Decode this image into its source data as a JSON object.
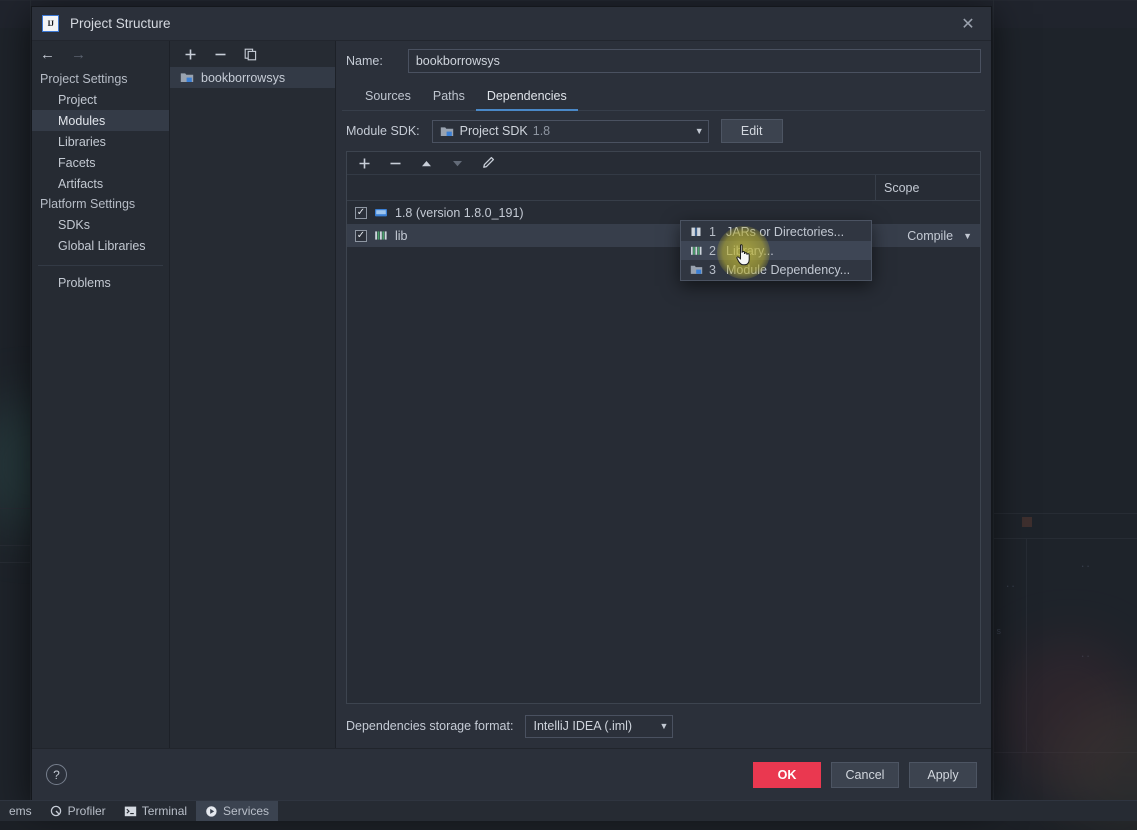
{
  "window": {
    "title": "Project Structure",
    "logo_text": "IJ",
    "close_icon": "close-icon"
  },
  "nav": {
    "back_icon": "arrow-left-icon",
    "forward_icon": "arrow-right-icon",
    "groups": [
      {
        "label": "Project Settings",
        "items": [
          {
            "label": "Project",
            "selected": false
          },
          {
            "label": "Modules",
            "selected": true
          },
          {
            "label": "Libraries",
            "selected": false
          },
          {
            "label": "Facets",
            "selected": false
          },
          {
            "label": "Artifacts",
            "selected": false
          }
        ]
      },
      {
        "label": "Platform Settings",
        "items": [
          {
            "label": "SDKs",
            "selected": false
          },
          {
            "label": "Global Libraries",
            "selected": false
          }
        ]
      }
    ],
    "problems_label": "Problems"
  },
  "modules_panel": {
    "toolbar": {
      "add_icon": "plus-icon",
      "remove_icon": "minus-icon",
      "copy_icon": "copy-icon"
    },
    "items": [
      {
        "label": "bookborrowsys",
        "icon": "module-icon",
        "selected": true
      }
    ]
  },
  "detail": {
    "name_label": "Name:",
    "name_value": "bookborrowsys",
    "name_placeholder": "",
    "tabs": [
      {
        "label": "Sources",
        "active": false
      },
      {
        "label": "Paths",
        "active": false
      },
      {
        "label": "Dependencies",
        "active": true
      }
    ],
    "sdk": {
      "label": "Module SDK:",
      "value": "Project SDK",
      "value_suffix": "1.8",
      "icon": "sdk-folder-icon",
      "edit_label": "Edit"
    },
    "dep_toolbar": {
      "add_icon": "plus-icon",
      "remove_icon": "minus-icon",
      "move_up_icon": "arrow-up-icon",
      "move_down_icon": "arrow-down-icon",
      "edit_icon": "pencil-icon"
    },
    "table": {
      "headers": {
        "export": "",
        "main": "",
        "scope": "Scope"
      },
      "rows": [
        {
          "checked": true,
          "icon": "sdk-icon",
          "label": "1.8 (version 1.8.0_191)",
          "scope": "",
          "selected": false,
          "occluded": true
        },
        {
          "checked": true,
          "icon": "library-icon",
          "label": "lib",
          "scope": "Compile",
          "selected": true,
          "occluded": false
        }
      ]
    },
    "storage": {
      "label": "Dependencies storage format:",
      "value": "IntelliJ IDEA (.iml)"
    }
  },
  "popup_menu": {
    "items": [
      {
        "num": "1",
        "label": "JARs or Directories...",
        "icon": "jar-icon",
        "hover": false
      },
      {
        "num": "2",
        "label": "Library...",
        "icon": "library-icon",
        "hover": true
      },
      {
        "num": "3",
        "label": "Module Dependency...",
        "icon": "module-icon",
        "hover": false
      }
    ]
  },
  "footer": {
    "help_label": "?",
    "ok_label": "OK",
    "cancel_label": "Cancel",
    "apply_label": "Apply"
  },
  "statusbar": {
    "items": [
      {
        "label": "ems",
        "icon": "problems-icon",
        "active": false,
        "show_icon": false
      },
      {
        "label": "Profiler",
        "icon": "profiler-icon",
        "active": false,
        "show_icon": true
      },
      {
        "label": "Terminal",
        "icon": "terminal-icon",
        "active": false,
        "show_icon": true
      },
      {
        "label": "Services",
        "icon": "services-icon",
        "active": true,
        "show_icon": true
      }
    ]
  },
  "colors": {
    "accent_primary": "#ea3850",
    "tab_underline": "#4a88c7",
    "dialog_bg": "#2b303a",
    "panel_bg": "#262b33",
    "cursor_highlight": "#c4bc3c"
  }
}
